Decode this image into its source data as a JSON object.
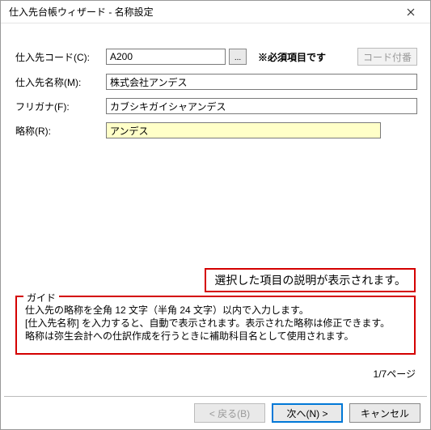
{
  "window": {
    "title": "仕入先台帳ウィザード - 名称設定",
    "close_aria": "閉じる"
  },
  "labels": {
    "code": "仕入先コード(C):",
    "name": "仕入先名称(M):",
    "furigana": "フリガナ(F):",
    "abbrev": "略称(R):"
  },
  "values": {
    "code": "A200",
    "name": "株式会社アンデス",
    "furigana": "カブシキガイシャアンデス",
    "abbrev": "アンデス"
  },
  "buttons": {
    "ellipsis": "...",
    "code_number": "コード付番",
    "back": "< 戻る(B)",
    "next": "次へ(N) >",
    "cancel": "キャンセル"
  },
  "required_label": "※必須項目です",
  "callout_text": "選択した項目の説明が表示されます。",
  "guide": {
    "legend": "ガイド",
    "line1": "仕入先の略称を全角 12 文字（半角 24 文字）以内で入力します。",
    "line2": "[仕入先名称] を入力すると、自動で表示されます。表示された略称は修正できます。",
    "line3": "略称は弥生会計への仕訳作成を行うときに補助科目名として使用されます。"
  },
  "page_indicator": "1/7ページ"
}
